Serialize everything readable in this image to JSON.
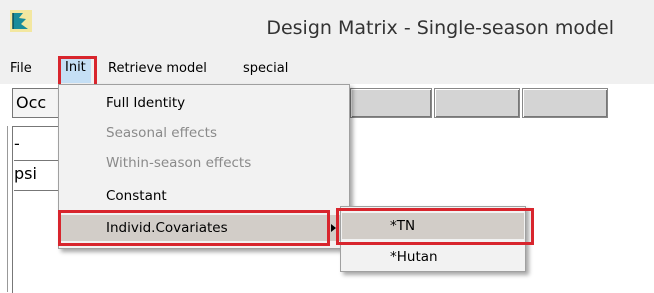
{
  "window": {
    "title": "Design Matrix - Single-season model",
    "icon": "program-flag-icon"
  },
  "menubar": {
    "items": [
      {
        "label": "File"
      },
      {
        "label": "Init"
      },
      {
        "label": "Retrieve model"
      },
      {
        "label": "special"
      }
    ]
  },
  "grid": {
    "occ_label": "Occ",
    "rows": [
      "-",
      "psi"
    ]
  },
  "init_menu": {
    "items": [
      {
        "label": "Full Identity",
        "enabled": true
      },
      {
        "label": "Seasonal effects",
        "enabled": false
      },
      {
        "label": "Within-season effects",
        "enabled": false
      },
      {
        "label": "Constant",
        "enabled": true
      },
      {
        "label": "Individ.Covariates",
        "enabled": true,
        "has_submenu": true
      }
    ]
  },
  "covariates_submenu": {
    "items": [
      {
        "label": "*TN"
      },
      {
        "label": "*Hutan"
      }
    ]
  },
  "colors": {
    "highlight_box": "#d8252d",
    "menu_hover": "#d2cdc8"
  }
}
